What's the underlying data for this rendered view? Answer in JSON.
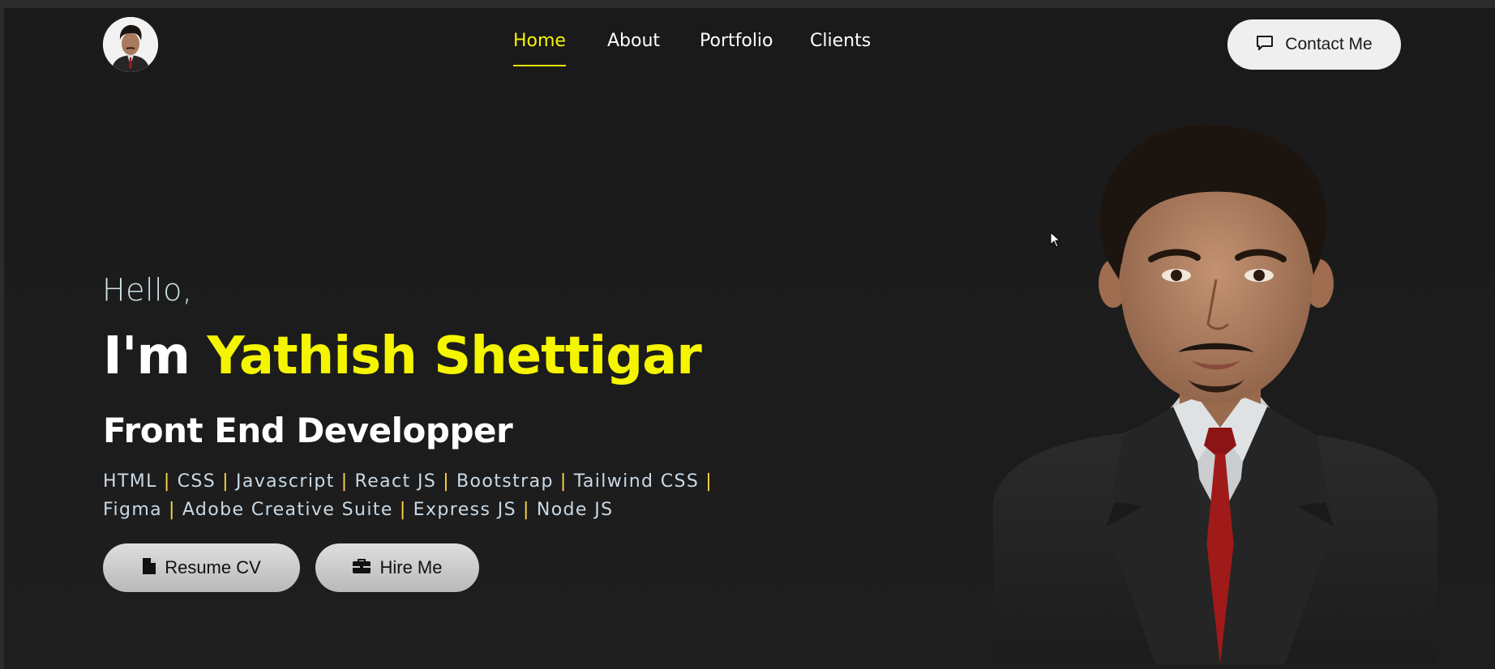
{
  "nav": {
    "links": [
      {
        "label": "Home",
        "active": true
      },
      {
        "label": "About",
        "active": false
      },
      {
        "label": "Portfolio",
        "active": false
      },
      {
        "label": "Clients",
        "active": false
      }
    ],
    "contact_label": "Contact Me",
    "contact_icon": "chat-bubble-icon"
  },
  "hero": {
    "greeting": "Hello,",
    "intro": "I'm",
    "name": "Yathish Shettigar",
    "role": "Front End Developper",
    "skills_line1": [
      "HTML",
      "CSS",
      "Javascript",
      "React JS",
      "Bootstrap",
      "Tailwind CSS"
    ],
    "skills_line2": [
      "Figma",
      "Adobe Creative Suite",
      "Express JS",
      "Node JS"
    ],
    "separator": "|",
    "resume_label": "Resume CV",
    "resume_icon": "file-icon",
    "hire_label": "Hire Me",
    "hire_icon": "briefcase-icon"
  },
  "colors": {
    "background": "#1a1a1a",
    "accent": "#f5f500",
    "text": "#ffffff",
    "button": "#dcdcdc"
  }
}
